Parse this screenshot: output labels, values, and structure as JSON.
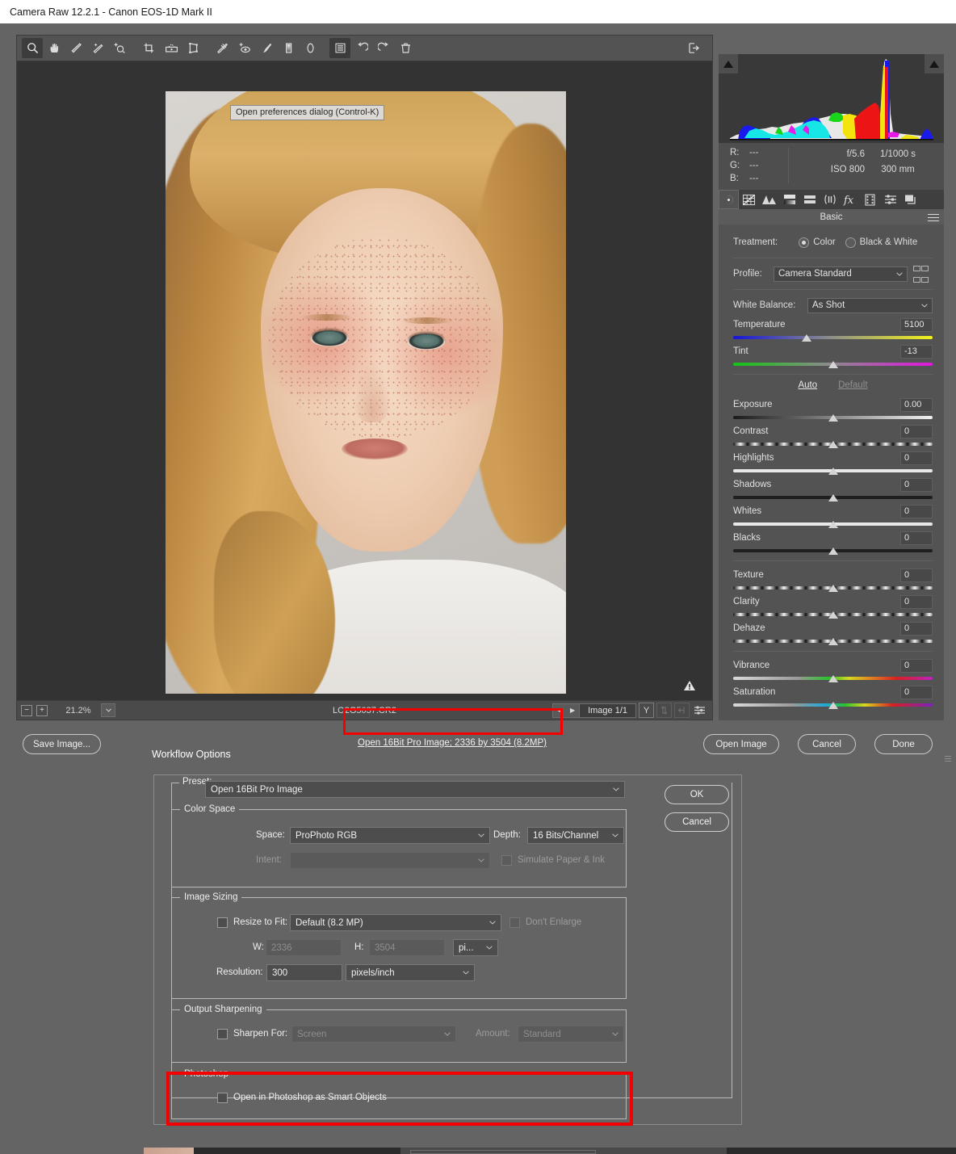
{
  "window": {
    "title": "Camera Raw 12.2.1  -  Canon EOS-1D Mark II"
  },
  "toolbar": {
    "tools": [
      {
        "name": "zoom-tool",
        "label": "Zoom"
      },
      {
        "name": "hand-tool",
        "label": "Hand"
      },
      {
        "name": "white-balance-tool",
        "label": "White Balance"
      },
      {
        "name": "color-sampler-tool",
        "label": "Color Sampler"
      },
      {
        "name": "targeted-adjustment-tool",
        "label": "Targeted Adjustment"
      },
      {
        "name": "crop-tool",
        "label": "Crop"
      },
      {
        "name": "straighten-tool",
        "label": "Straighten"
      },
      {
        "name": "transform-tool",
        "label": "Transform"
      },
      {
        "name": "spot-removal-tool",
        "label": "Spot Removal"
      },
      {
        "name": "red-eye-tool",
        "label": "Red Eye Removal"
      },
      {
        "name": "adjustment-brush-tool",
        "label": "Adjustment Brush"
      },
      {
        "name": "graduated-filter-tool",
        "label": "Graduated Filter"
      },
      {
        "name": "radial-filter-tool",
        "label": "Radial Filter"
      },
      {
        "name": "preferences-tool",
        "label": "Open preferences dialog (Control-K)"
      },
      {
        "name": "rotate-left-tool",
        "label": "Rotate Counterclockwise"
      },
      {
        "name": "rotate-right-tool",
        "label": "Rotate Clockwise"
      },
      {
        "name": "delete-tool",
        "label": "Delete"
      },
      {
        "name": "toggle-filmstrip-tool",
        "label": "Toggle Filmstrip"
      }
    ]
  },
  "canvas": {
    "tooltip": "Open preferences dialog (Control-K)",
    "warning_icon": "warning-triangle-icon"
  },
  "statusbar": {
    "zoom_out": "−",
    "zoom_in": "+",
    "zoom_level": "21.2%",
    "filename": "LO2G5037.CR2",
    "prev": "◀",
    "next": "▶",
    "image_count": "Image 1/1",
    "rating_btn": "Y",
    "sync_btn": "sync-icon",
    "filmstrip_btn": "filmstrip-icon",
    "settings_btn": "sliders-icon"
  },
  "histogram": {
    "shadow_clip_icon": "shadow-clipping-triangle-icon",
    "highlight_clip_icon": "highlight-clipping-triangle-icon"
  },
  "info": {
    "channels": [
      {
        "label": "R:",
        "value": "---"
      },
      {
        "label": "G:",
        "value": "---"
      },
      {
        "label": "B:",
        "value": "---"
      }
    ],
    "aperture": "f/5.6",
    "shutter": "1/1000 s",
    "iso": "ISO 800",
    "focal_length": "300 mm"
  },
  "panel_tabs": [
    {
      "name": "tab-basic",
      "icon": "aperture-icon",
      "selected": true
    },
    {
      "name": "tab-tone-curve",
      "icon": "tone-curve-icon",
      "selected": false
    },
    {
      "name": "tab-detail",
      "icon": "detail-triangles-icon",
      "selected": false
    },
    {
      "name": "tab-hsl",
      "icon": "hsl-gradient-icon",
      "selected": false
    },
    {
      "name": "tab-split-toning",
      "icon": "split-toning-icon",
      "selected": false
    },
    {
      "name": "tab-lens-corrections",
      "icon": "lens-corrections-icon",
      "selected": false
    },
    {
      "name": "tab-effects",
      "icon": "fx-icon",
      "selected": false
    },
    {
      "name": "tab-calibration",
      "icon": "filmstrip-calibration-icon",
      "selected": false
    },
    {
      "name": "tab-presets",
      "icon": "sliders-presets-icon",
      "selected": false
    },
    {
      "name": "tab-snapshots",
      "icon": "snapshots-layers-icon",
      "selected": false
    }
  ],
  "panel": {
    "title": "Basic",
    "menu_icon": "panel-menu-icon",
    "treatment_label": "Treatment:",
    "treatment_color": "Color",
    "treatment_bw": "Black & White",
    "profile_label": "Profile:",
    "profile_value": "Camera Standard",
    "profile_browse_icon": "profile-browser-grid-icon",
    "wb_label": "White Balance:",
    "wb_value": "As Shot",
    "auto": "Auto",
    "default": "Default",
    "sliders": [
      {
        "name": "temperature",
        "label": "Temperature",
        "value": "5100",
        "pos": 37,
        "bar": "temp"
      },
      {
        "name": "tint",
        "label": "Tint",
        "value": "-13",
        "pos": 50,
        "bar": "tint"
      },
      {
        "name": "exposure",
        "label": "Exposure",
        "value": "0.00",
        "pos": 50,
        "bar": "gray"
      },
      {
        "name": "contrast",
        "label": "Contrast",
        "value": "0",
        "pos": 50,
        "bar": "contrast"
      },
      {
        "name": "highlights",
        "label": "Highlights",
        "value": "0",
        "pos": 50,
        "bar": "white"
      },
      {
        "name": "shadows",
        "label": "Shadows",
        "value": "0",
        "pos": 50,
        "bar": "dark"
      },
      {
        "name": "whites",
        "label": "Whites",
        "value": "0",
        "pos": 50,
        "bar": "white"
      },
      {
        "name": "blacks",
        "label": "Blacks",
        "value": "0",
        "pos": 50,
        "bar": "dark"
      },
      {
        "name": "texture",
        "label": "Texture",
        "value": "0",
        "pos": 50,
        "bar": "contrast"
      },
      {
        "name": "clarity",
        "label": "Clarity",
        "value": "0",
        "pos": 50,
        "bar": "contrast"
      },
      {
        "name": "dehaze",
        "label": "Dehaze",
        "value": "0",
        "pos": 50,
        "bar": "contrast"
      },
      {
        "name": "vibrance",
        "label": "Vibrance",
        "value": "0",
        "pos": 50,
        "bar": "vib"
      },
      {
        "name": "saturation",
        "label": "Saturation",
        "value": "0",
        "pos": 50,
        "bar": "sat"
      }
    ]
  },
  "footer": {
    "save_image": "Save Image...",
    "workflow_link": "Open 16Bit Pro Image; 2336 by 3504 (8.2MP)",
    "open_image": "Open Image",
    "cancel": "Cancel",
    "done": "Done"
  },
  "workflow_options": {
    "title": "Workflow Options",
    "preset_label": "Preset:",
    "preset_value": "Open 16Bit Pro Image",
    "ok": "OK",
    "cancel": "Cancel",
    "color_space": {
      "caption": "Color Space",
      "space_label": "Space:",
      "space_value": "ProPhoto RGB",
      "depth_label": "Depth:",
      "depth_value": "16 Bits/Channel",
      "intent_label": "Intent:",
      "intent_value": "",
      "simulate_label": "Simulate Paper & Ink"
    },
    "image_sizing": {
      "caption": "Image Sizing",
      "resize_label": "Resize to Fit:",
      "resize_value": "Default  (8.2 MP)",
      "dont_enlarge_label": "Don't Enlarge",
      "w_label": "W:",
      "w_value": "2336",
      "h_label": "H:",
      "h_value": "3504",
      "unit_value": "pi...",
      "resolution_label": "Resolution:",
      "resolution_value": "300",
      "resolution_unit": "pixels/inch"
    },
    "output_sharpening": {
      "caption": "Output Sharpening",
      "sharpen_label": "Sharpen For:",
      "sharpen_value": "Screen",
      "amount_label": "Amount:",
      "amount_value": "Standard"
    },
    "photoshop": {
      "caption": "Photoshop",
      "smart_objects_label": "Open in Photoshop as Smart Objects"
    }
  },
  "annotations": {
    "highlight_color": "#f50000"
  }
}
